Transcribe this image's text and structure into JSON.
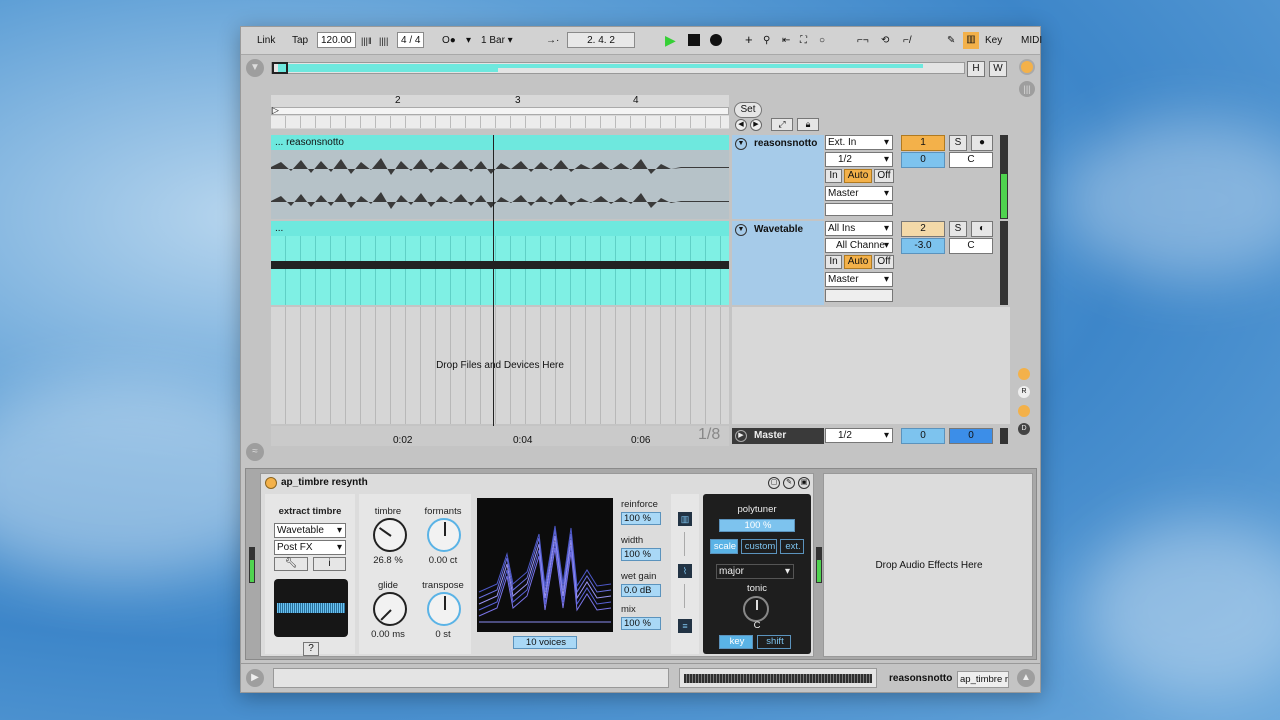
{
  "transport": {
    "link": "Link",
    "tap": "Tap",
    "tempo": "120.00",
    "signature": "4 / 4",
    "quantize": "1 Bar",
    "position": "2.   4.   2",
    "key": "Key",
    "midi": "MIDI"
  },
  "overview": {
    "h": "H",
    "w": "W"
  },
  "ruler": {
    "bars": [
      "2",
      "3",
      "4"
    ],
    "set": "Set",
    "times": [
      "0:02",
      "0:04",
      "0:06"
    ],
    "zoom": "1/8"
  },
  "tracks": [
    {
      "clip_name": "... reasonsnotto",
      "name": "reasonsnotto",
      "input": "Ext. In",
      "channel": "1/2",
      "monitor": [
        "In",
        "Auto",
        "Off"
      ],
      "output": "Master",
      "number": "1",
      "solo": "S",
      "volume": "0",
      "pan": "C",
      "color": "#6ee8de"
    },
    {
      "clip_name": "...",
      "name": "Wavetable",
      "input": "All Ins",
      "channel": "All Channe",
      "monitor": [
        "In",
        "Auto",
        "Off"
      ],
      "output": "Master",
      "number": "2",
      "solo": "S",
      "volume": "-3.0",
      "pan": "C",
      "color": "#6ee8de"
    }
  ],
  "drop_files": "Drop Files and Devices Here",
  "master": {
    "name": "Master",
    "channel": "1/2",
    "volume": "0",
    "pan": "0"
  },
  "right_buttons": [
    "R",
    "D"
  ],
  "device": {
    "title": "ap_timbre resynth",
    "extract_label": "extract timbre",
    "source": "Wavetable",
    "source_mode": "Post FX",
    "info": "i",
    "help": "?",
    "knobs": [
      {
        "label": "timbre",
        "value": "26.8 %"
      },
      {
        "label": "formants",
        "value": "0.00 ct"
      },
      {
        "label": "glide",
        "value": "0.00 ms"
      },
      {
        "label": "transpose",
        "value": "0 st"
      }
    ],
    "voices": "10 voices",
    "params": [
      {
        "label": "reinforce",
        "value": "100 %"
      },
      {
        "label": "width",
        "value": "100 %"
      },
      {
        "label": "wet gain",
        "value": "0.0 dB"
      },
      {
        "label": "mix",
        "value": "100 %"
      }
    ],
    "polytuner": {
      "title": "polytuner",
      "amount": "100 %",
      "modes": [
        "scale",
        "custom",
        "ext."
      ],
      "scale": "major",
      "tonic_label": "tonic",
      "tonic": "C",
      "buttons": [
        "key",
        "shift"
      ]
    }
  },
  "drop_effects": "Drop Audio Effects Here",
  "status": {
    "track": "reasonsnotto",
    "device": "ap_timbre r"
  }
}
